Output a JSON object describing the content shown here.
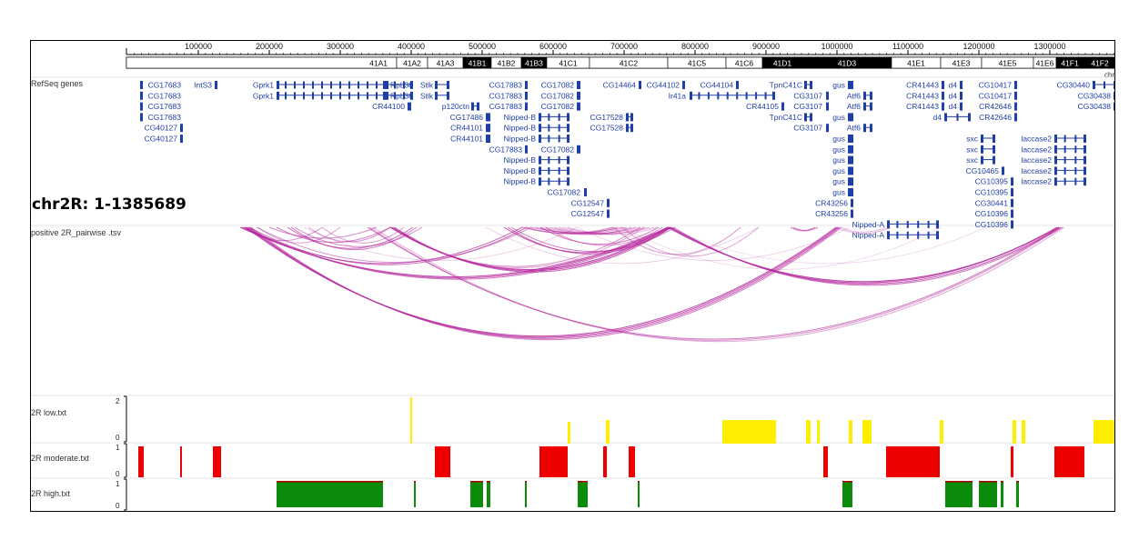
{
  "coord_title": "chr2R: 1-1385689",
  "colors": {
    "gene": "#1f3fa8",
    "arc": "#b5279c",
    "low": "#ffee00",
    "moderate": "#ee0000",
    "high": "#0a8c0a"
  },
  "ruler": {
    "ticks": [
      "100000",
      "200000",
      "300000",
      "400000",
      "500000",
      "600000",
      "700000",
      "800000",
      "900000",
      "1000000",
      "1100000",
      "1200000",
      "1300000",
      "14"
    ],
    "chr_label": "chr"
  },
  "bands": [
    "41A1",
    "41A2",
    "41A3",
    "41B1",
    "41B2",
    "41B3",
    "41C1",
    "41C2",
    "41C5",
    "41C6",
    "41D1",
    "41D3",
    "41E1",
    "41E3",
    "41E5",
    "41E6",
    "41F1",
    "41F2"
  ],
  "tracks": {
    "refseq": "RefSeq genes",
    "pairwise": "positive 2R_pairwise .tsv",
    "low": "2R low.txt",
    "moderate": "2R moderate.txt",
    "high": "2R high.txt"
  },
  "yaxis": {
    "low_max": "2",
    "low_min": "0",
    "moderate_max": "1",
    "moderate_min": "0",
    "high_max": "1",
    "high_min": "0"
  },
  "genes": [
    "CG17683",
    "CG17683",
    "CG17683",
    "CG17683",
    "CG40127",
    "CG40127",
    "IntS3",
    "Gprk1",
    "Gprk1",
    "RpL38",
    "RpL38",
    "CR44100",
    "Stlk",
    "Stlk",
    "p120ctn",
    "CG17883",
    "CG17883",
    "CG17883",
    "CG17486",
    "CR44101",
    "CR44101",
    "CG17883",
    "CG17082",
    "CG17082",
    "CG17082",
    "Nipped-B",
    "Nipped-B",
    "Nipped-B",
    "CG17082",
    "Nipped-B",
    "Nipped-B",
    "Nipped-B",
    "CG17082",
    "CG12547",
    "CG12547",
    "CG14464",
    "CG17528",
    "CG17528",
    "CG44102",
    "Ir41a",
    "CG44104",
    "CR44105",
    "TpnC41C",
    "TpnC41C",
    "CG3107",
    "CG3107",
    "CG3107",
    "gus",
    "gus",
    "gus",
    "gus",
    "gus",
    "gus",
    "gus",
    "gus",
    "Atf6",
    "Atf6",
    "Atf6",
    "CR43256",
    "CR43256",
    "Nipped-A",
    "Nipped-A",
    "CR41443",
    "CR41443",
    "CR41443",
    "d4",
    "d4",
    "d4",
    "d4",
    "CG10417",
    "CG10417",
    "CR42646",
    "CR42646",
    "sxc",
    "sxc",
    "sxc",
    "CG10465",
    "CG10395",
    "CG10395",
    "CG30441",
    "CG10396",
    "CG10396",
    "CG30440",
    "CG30438",
    "CG30438",
    "laccase2",
    "laccase2",
    "laccase2",
    "laccase2",
    "laccase2"
  ]
}
